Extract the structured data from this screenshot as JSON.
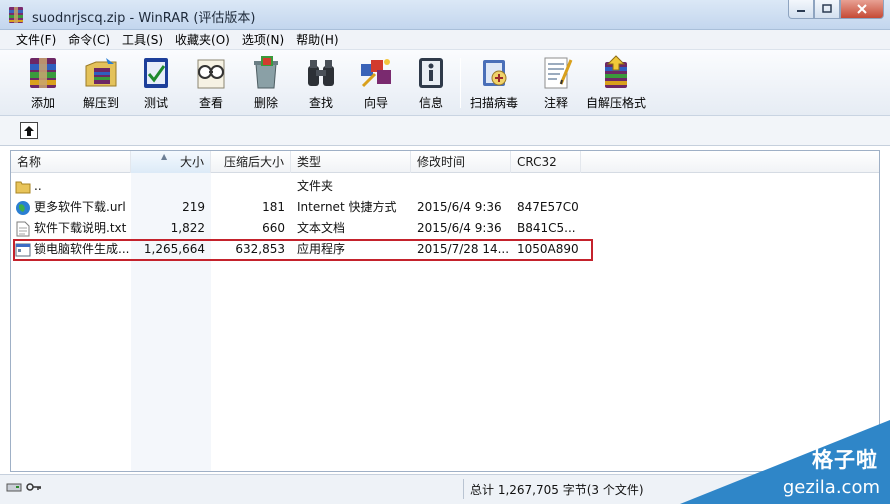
{
  "window": {
    "title": "suodnrjscq.zip - WinRAR (评估版本)"
  },
  "menu": [
    {
      "label": "文件(F)"
    },
    {
      "label": "命令(C)"
    },
    {
      "label": "工具(S)"
    },
    {
      "label": "收藏夹(O)"
    },
    {
      "label": "选项(N)"
    },
    {
      "label": "帮助(H)"
    }
  ],
  "toolbar": [
    {
      "label": "添加",
      "icon": "add-archive-icon"
    },
    {
      "label": "解压到",
      "icon": "extract-to-icon"
    },
    {
      "label": "测试",
      "icon": "test-icon"
    },
    {
      "label": "查看",
      "icon": "view-icon"
    },
    {
      "label": "删除",
      "icon": "delete-icon"
    },
    {
      "label": "查找",
      "icon": "find-icon"
    },
    {
      "label": "向导",
      "icon": "wizard-icon"
    },
    {
      "label": "信息",
      "icon": "info-icon"
    },
    {
      "label": "扫描病毒",
      "icon": "virus-scan-icon"
    },
    {
      "label": "注释",
      "icon": "comment-icon"
    },
    {
      "label": "自解压格式",
      "icon": "sfx-icon"
    }
  ],
  "list": {
    "columns": [
      "名称",
      "大小",
      "压缩后大小",
      "类型",
      "修改时间",
      "CRC32"
    ],
    "sort_column": "大小",
    "rows": [
      {
        "name": "..",
        "size": "",
        "packed": "",
        "type": "文件夹",
        "modified": "",
        "crc": "",
        "icon": "folder-icon"
      },
      {
        "name": "更多软件下载.url",
        "size": "219",
        "packed": "181",
        "type": "Internet 快捷方式",
        "modified": "2015/6/4 9:36",
        "crc": "847E57C0",
        "icon": "globe-icon"
      },
      {
        "name": "软件下载说明.txt",
        "size": "1,822",
        "packed": "660",
        "type": "文本文档",
        "modified": "2015/6/4 9:36",
        "crc": "B841C5...",
        "icon": "text-file-icon"
      },
      {
        "name": "锁电脑软件生成...",
        "size": "1,265,664",
        "packed": "632,853",
        "type": "应用程序",
        "modified": "2015/7/28 14...",
        "crc": "1050A890",
        "icon": "exe-icon",
        "highlighted": true
      }
    ]
  },
  "status": {
    "summary": "总计 1,267,705 字节(3 个文件)"
  },
  "watermark": {
    "title": "格子啦",
    "url": "gezila.com",
    "color": "#2f86c8"
  }
}
